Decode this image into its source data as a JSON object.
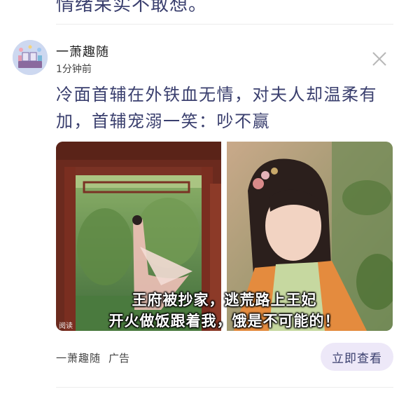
{
  "previous_post": {
    "text_fragment": "情绪呆实不敢想。"
  },
  "post": {
    "author": "一萧趣随",
    "time": "1分钟前",
    "title": "冷面首辅在外铁血无情，对夫人却温柔有加，首辅宠溺一笑：吵不赢",
    "image": {
      "caption_line1": "王府被抄家，逃荒路上王妃",
      "caption_line2": "开火做饭跟着我，饿是不可能的！",
      "watermark": "阅读"
    },
    "ad": {
      "source": "一萧趣随",
      "label": "广告",
      "cta": "立即查看"
    }
  },
  "colors": {
    "title": "#3a3f6e",
    "cta_bg": "#ede8f8"
  },
  "icons": {
    "close": "close-icon",
    "avatar": "avatar-illustration"
  }
}
